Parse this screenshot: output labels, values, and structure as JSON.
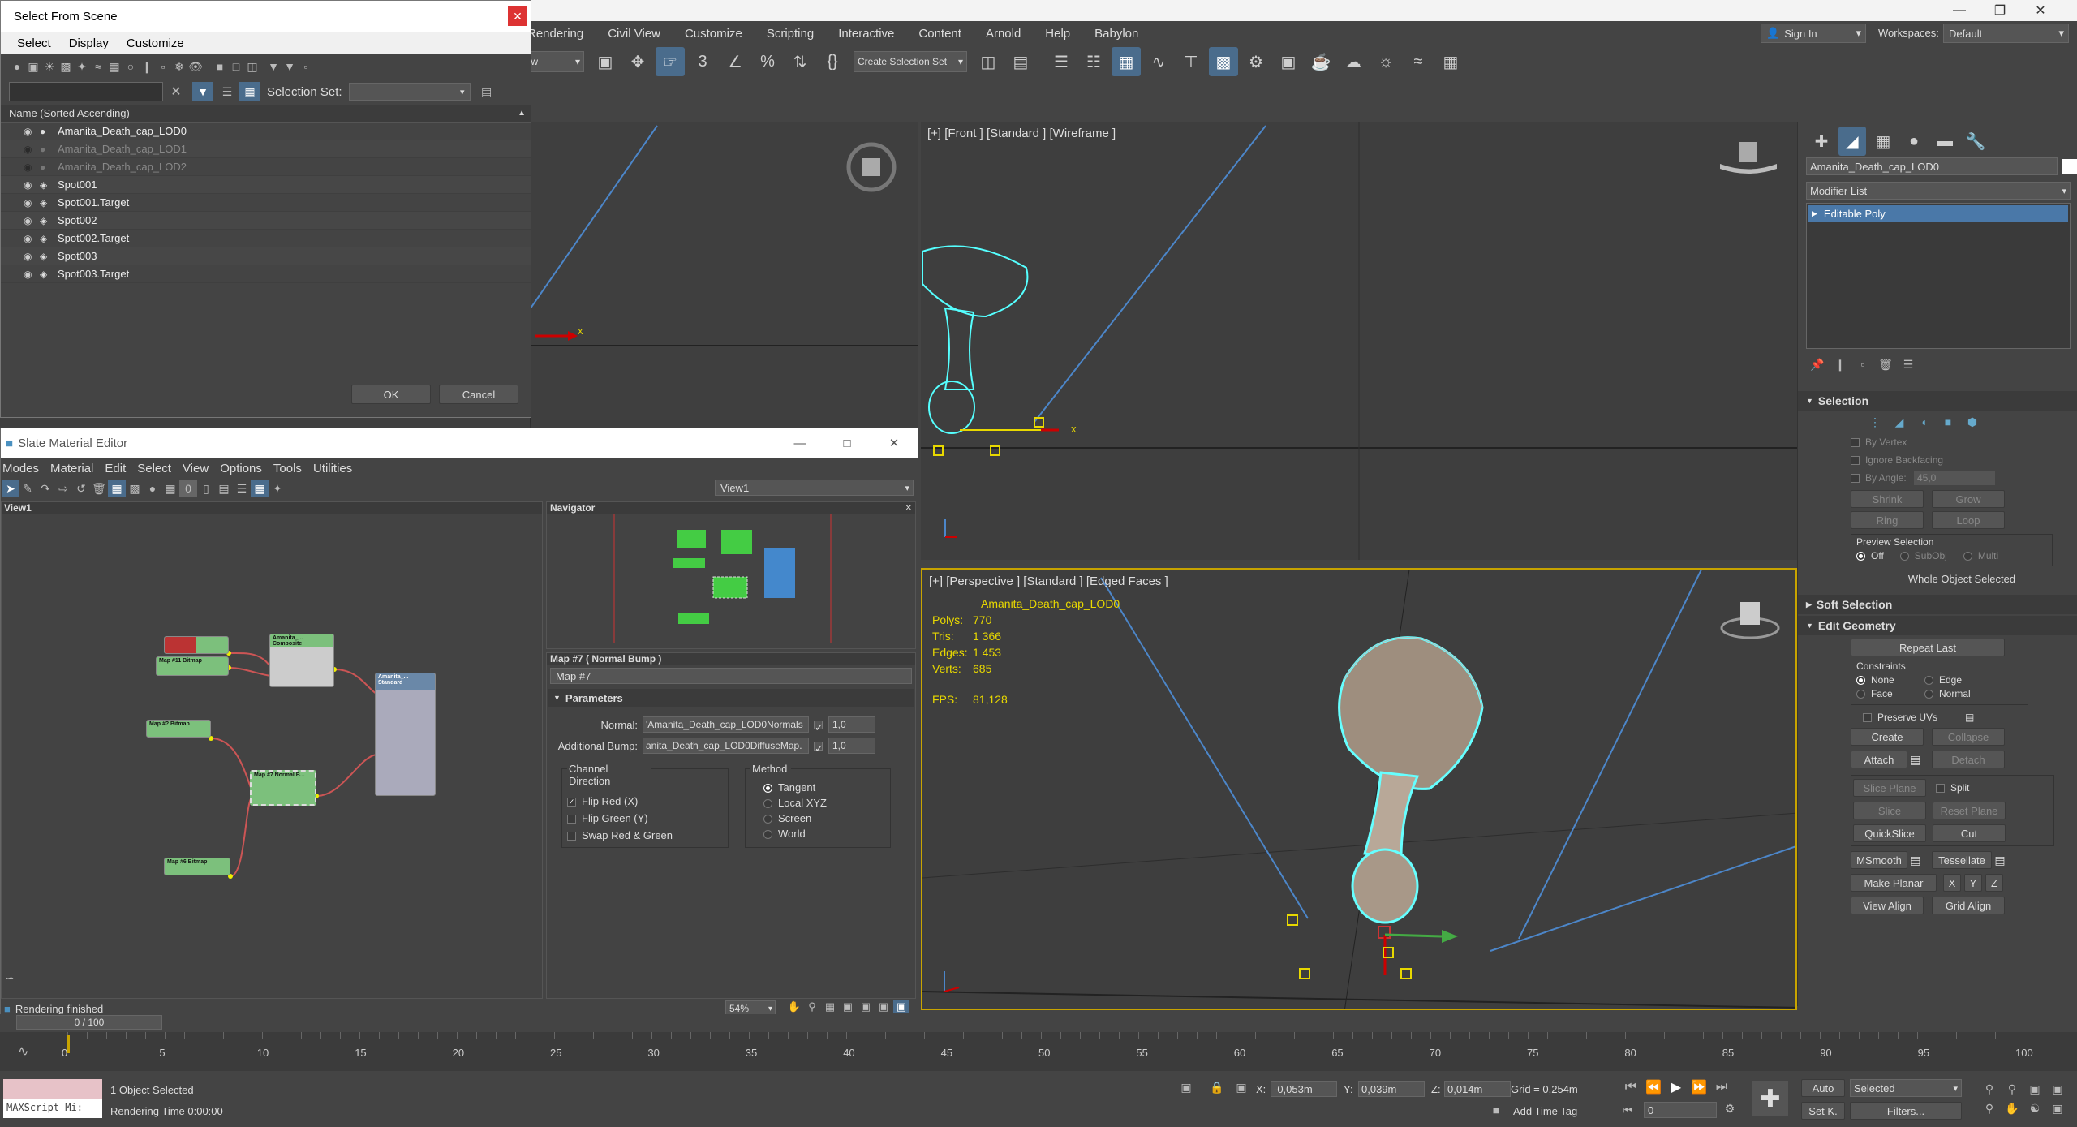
{
  "menu": {
    "items": [
      "Rendering",
      "Civil View",
      "Customize",
      "Scripting",
      "Interactive",
      "Content",
      "Arnold",
      "Help",
      "Babylon"
    ]
  },
  "user": {
    "signin": "Sign In",
    "workspaces_label": "Workspaces:",
    "workspace_value": "Default"
  },
  "toolbar": {
    "selection_set": "Create Selection Set"
  },
  "select_dialog": {
    "title": "Select From Scene",
    "menus": [
      "Select",
      "Display",
      "Customize"
    ],
    "selection_set_label": "Selection Set:",
    "column_header": "Name (Sorted Ascending)",
    "items": [
      {
        "name": "Amanita_Death_cap_LOD0",
        "hidden": false
      },
      {
        "name": "Amanita_Death_cap_LOD1",
        "hidden": true
      },
      {
        "name": "Amanita_Death_cap_LOD2",
        "hidden": true
      },
      {
        "name": "Spot001",
        "hidden": false
      },
      {
        "name": "Spot001.Target",
        "hidden": false
      },
      {
        "name": "Spot002",
        "hidden": false
      },
      {
        "name": "Spot002.Target",
        "hidden": false
      },
      {
        "name": "Spot003",
        "hidden": false
      },
      {
        "name": "Spot003.Target",
        "hidden": false
      }
    ],
    "ok": "OK",
    "cancel": "Cancel"
  },
  "slate": {
    "title": "Slate Material Editor",
    "menus": [
      "Modes",
      "Material",
      "Edit",
      "Select",
      "View",
      "Options",
      "Tools",
      "Utilities"
    ],
    "view_dropdown": "View1",
    "view_tab": "View1",
    "navigator_title": "Navigator",
    "map_title": "Map #7  ( Normal Bump )",
    "map_name": "Map #7",
    "params_title": "Parameters",
    "normal_label": "Normal:",
    "normal_value": "'Amanita_Death_cap_LOD0Normals",
    "normal_amount": "1,0",
    "bump_label": "Additional Bump:",
    "bump_value": "anita_Death_cap_LOD0DiffuseMap.",
    "bump_amount": "1,0",
    "channel_title": "Channel Direction",
    "flip_red": "Flip Red (X)",
    "flip_green": "Flip Green (Y)",
    "swap": "Swap Red & Green",
    "method_title": "Method",
    "methods": [
      "Tangent",
      "Local XYZ",
      "Screen",
      "World"
    ],
    "status": "Rendering finished",
    "zoom": "54%",
    "nodes": {
      "composite_title": "Amanita_... Composite",
      "bitmap1": "Map #11 Bitmap",
      "bitmap2": "Map #? Bitmap",
      "bitmap3": "Map #5 Bitmap",
      "bitmap4": "Map #6 Bitmap",
      "normal_title": "Map #7 Normal B...",
      "standard_title": "Amanita_... Standard"
    }
  },
  "viewports": {
    "front_label": "[+] [Front ] [Standard ] [Wireframe ]",
    "persp_label": "[+] [Perspective ] [Standard ] [Edged Faces ]",
    "stats": {
      "object": "Amanita_Death_cap_LOD0",
      "polys_label": "Polys:",
      "polys": "770",
      "tris_label": "Tris:",
      "tris": "1 366",
      "edges_label": "Edges:",
      "edges": "1 453",
      "verts_label": "Verts:",
      "verts": "685",
      "fps_label": "FPS:",
      "fps": "81,128"
    }
  },
  "command_panel": {
    "object_name": "Amanita_Death_cap_LOD0",
    "modifier_list": "Modifier List",
    "stack_item": "Editable Poly",
    "selection": {
      "title": "Selection",
      "by_vertex": "By Vertex",
      "ignore_backfacing": "Ignore Backfacing",
      "by_angle": "By Angle:",
      "angle_value": "45,0",
      "shrink": "Shrink",
      "grow": "Grow",
      "ring": "Ring",
      "loop": "Loop",
      "preview_title": "Preview Selection",
      "off": "Off",
      "subobj": "SubObj",
      "multi": "Multi",
      "whole": "Whole Object Selected"
    },
    "soft_selection": "Soft Selection",
    "edit_geometry": {
      "title": "Edit Geometry",
      "repeat_last": "Repeat Last",
      "constraints": "Constraints",
      "none": "None",
      "edge": "Edge",
      "face": "Face",
      "normal": "Normal",
      "preserve_uvs": "Preserve UVs",
      "create": "Create",
      "collapse": "Collapse",
      "attach": "Attach",
      "detach": "Detach",
      "slice_plane": "Slice Plane",
      "split": "Split",
      "slice": "Slice",
      "reset_plane": "Reset Plane",
      "quickslice": "QuickSlice",
      "cut": "Cut",
      "msmooth": "MSmooth",
      "tessellate": "Tessellate",
      "make_planar": "Make Planar",
      "x": "X",
      "y": "Y",
      "z": "Z",
      "view_align": "View Align",
      "grid_align": "Grid Align"
    }
  },
  "timeline": {
    "frame": "0 / 100",
    "ticks": [
      "0",
      "5",
      "10",
      "15",
      "20",
      "25",
      "30",
      "35",
      "40",
      "45",
      "50",
      "55",
      "60",
      "65",
      "70",
      "75",
      "80",
      "85",
      "90",
      "95",
      "100"
    ]
  },
  "status_bar": {
    "maxscript": "MAXScript Mi:",
    "selected": "1 Object Selected",
    "render_time": "Rendering Time  0:00:00",
    "x_label": "X:",
    "x": "-0,053m",
    "y_label": "Y:",
    "y": "0,039m",
    "z_label": "Z:",
    "z": "0,014m",
    "grid": "Grid = 0,254m",
    "add_time_tag": "Add Time Tag",
    "auto": "Auto",
    "setk": "Set K.",
    "selected_dropdown": "Selected",
    "filters": "Filters...",
    "frame_value": "0"
  }
}
